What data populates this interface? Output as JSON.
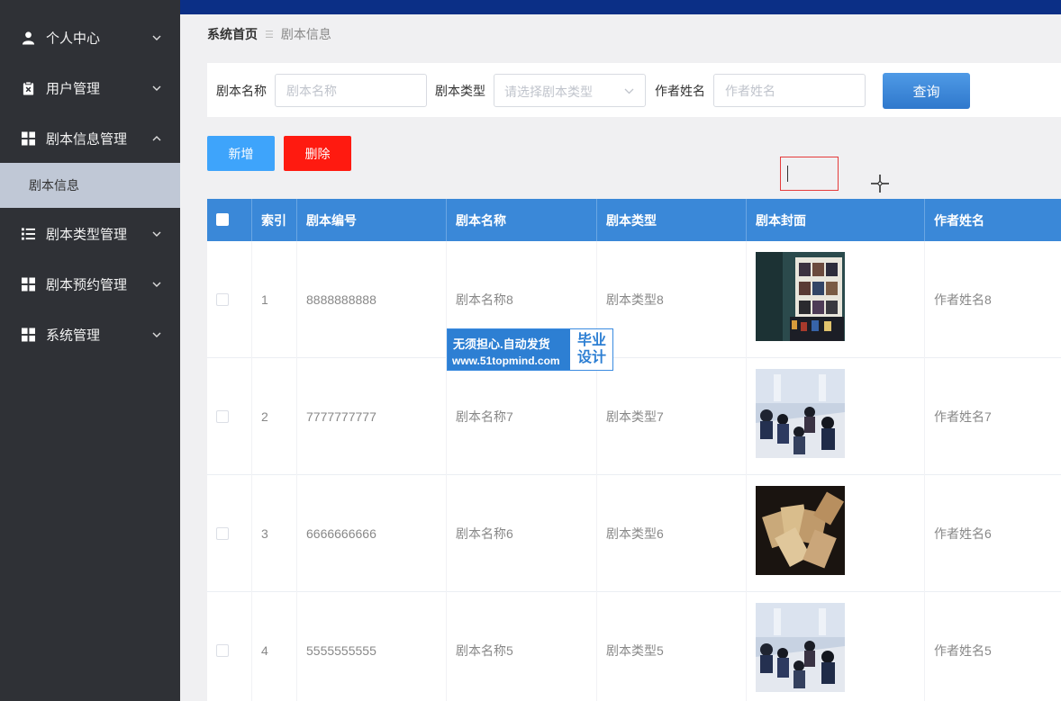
{
  "sidebar": {
    "items": [
      {
        "label": "个人中心",
        "icon": "user-icon"
      },
      {
        "label": "用户管理",
        "icon": "clipboard-x-icon"
      },
      {
        "label": "剧本信息管理",
        "icon": "grid-icon",
        "expanded": true,
        "children": [
          {
            "label": "剧本信息",
            "active": true
          }
        ]
      },
      {
        "label": "剧本类型管理",
        "icon": "list-icon"
      },
      {
        "label": "剧本预约管理",
        "icon": "grid-icon"
      },
      {
        "label": "系统管理",
        "icon": "grid-icon"
      }
    ]
  },
  "breadcrumb": {
    "home": "系统首页",
    "current": "剧本信息"
  },
  "search": {
    "name_label": "剧本名称",
    "name_placeholder": "剧本名称",
    "type_label": "剧本类型",
    "type_placeholder": "请选择剧本类型",
    "author_label": "作者姓名",
    "author_placeholder": "作者姓名",
    "query_button": "查询"
  },
  "actions": {
    "add": "新增",
    "delete": "删除"
  },
  "table": {
    "columns": [
      "索引",
      "剧本编号",
      "剧本名称",
      "剧本类型",
      "剧本封面",
      "作者姓名"
    ],
    "rows": [
      {
        "index": "1",
        "code": "8888888888",
        "name": "剧本名称8",
        "type": "剧本类型8",
        "cover": "bookshelf-room-photo",
        "author": "作者姓名8"
      },
      {
        "index": "2",
        "code": "7777777777",
        "name": "剧本名称7",
        "type": "剧本类型7",
        "cover": "group-at-table-photo",
        "author": "作者姓名7"
      },
      {
        "index": "3",
        "code": "6666666666",
        "name": "剧本名称6",
        "type": "剧本类型6",
        "cover": "cards-on-table-photo",
        "author": "作者姓名6"
      },
      {
        "index": "4",
        "code": "5555555555",
        "name": "剧本名称5",
        "type": "剧本类型5",
        "cover": "group-at-table-photo",
        "author": "作者姓名5"
      }
    ]
  },
  "watermark": {
    "line1": "无须担心.自动发货",
    "line2": "www.51topmind.com",
    "side1": "毕业",
    "side2": "设计"
  },
  "colors": {
    "sidebar": "#2f3136",
    "topbar": "#0b2f86",
    "table_header": "#3a88d8",
    "add_button": "#3ea4fb",
    "delete_button": "#ff1a10",
    "query_button": "#3a86d6"
  }
}
